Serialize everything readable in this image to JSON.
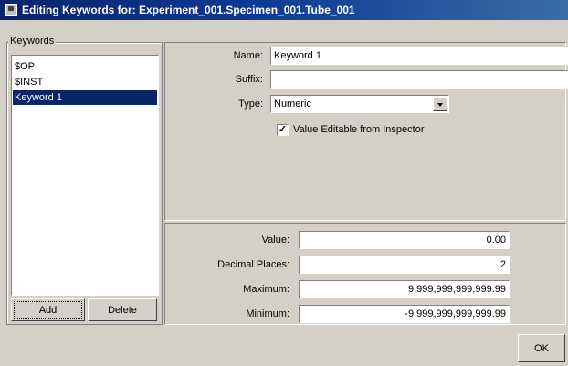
{
  "window": {
    "title": "Editing Keywords for: Experiment_001.Specimen_001.Tube_001"
  },
  "keywords_group": {
    "label": "Keywords",
    "items": [
      {
        "label": "$OP"
      },
      {
        "label": "$INST"
      },
      {
        "label": "Keyword 1"
      }
    ],
    "selected_index": 2,
    "add_label": "Add",
    "delete_label": "Delete"
  },
  "properties": {
    "name_label": "Name:",
    "name_value": "Keyword 1",
    "suffix_label": "Suffix:",
    "suffix_value": "",
    "type_label": "Type:",
    "type_value": "Numeric",
    "editable_label": "Value Editable from Inspector",
    "editable_checked": true,
    "check_mark": "✓"
  },
  "value_settings": {
    "value_label": "Value:",
    "value": "0.00",
    "decimal_label": "Decimal Places:",
    "decimal_value": "2",
    "maximum_label": "Maximum:",
    "maximum_value": "9,999,999,999,999.99",
    "minimum_label": "Minimum:",
    "minimum_value": "-9,999,999,999,999.99"
  },
  "footer": {
    "ok_label": "OK"
  },
  "colors": {
    "titlebar": "#0a246a",
    "selection": "#0a246a",
    "face": "#d4d0c8"
  }
}
